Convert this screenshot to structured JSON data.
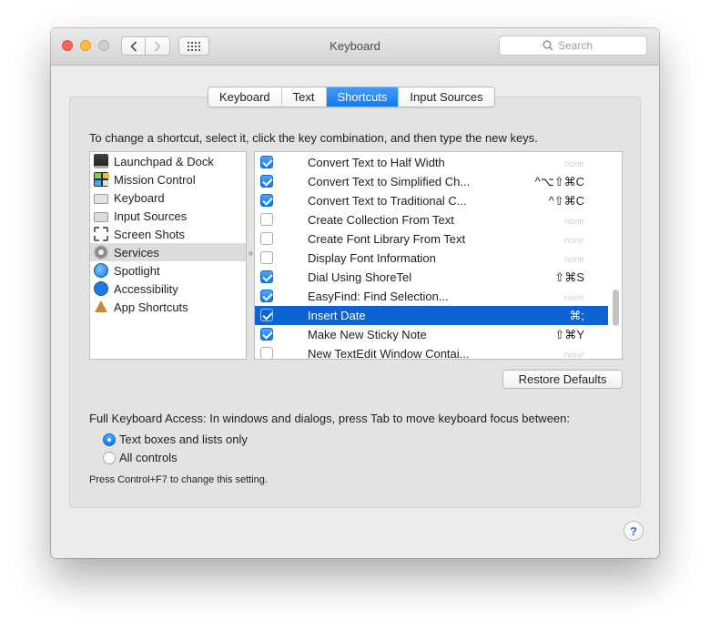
{
  "window": {
    "title": "Keyboard"
  },
  "toolbar": {
    "back_icon": "chevron-left-icon",
    "forward_icon": "chevron-right-icon",
    "show_all_icon": "grid-icon",
    "search_placeholder": "Search"
  },
  "tabs": [
    {
      "label": "Keyboard",
      "active": false
    },
    {
      "label": "Text",
      "active": false
    },
    {
      "label": "Shortcuts",
      "active": true
    },
    {
      "label": "Input Sources",
      "active": false
    }
  ],
  "instructions": "To change a shortcut, select it, click the key combination, and then type the new keys.",
  "categories": [
    {
      "label": "Launchpad & Dock",
      "icon": "launchpad-icon"
    },
    {
      "label": "Mission Control",
      "icon": "mission-control-icon"
    },
    {
      "label": "Keyboard",
      "icon": "keyboard-icon"
    },
    {
      "label": "Input Sources",
      "icon": "input-sources-icon"
    },
    {
      "label": "Screen Shots",
      "icon": "screenshot-icon"
    },
    {
      "label": "Services",
      "icon": "services-gear-icon",
      "selected": true
    },
    {
      "label": "Spotlight",
      "icon": "spotlight-icon"
    },
    {
      "label": "Accessibility",
      "icon": "accessibility-icon"
    },
    {
      "label": "App Shortcuts",
      "icon": "app-shortcuts-icon"
    }
  ],
  "services": [
    {
      "name": "Convert Text to Half Width",
      "checked": true,
      "shortcut": "none"
    },
    {
      "name": "Convert Text to Simplified Ch...",
      "checked": true,
      "shortcut": "^⌥⇧⌘C"
    },
    {
      "name": "Convert Text to Traditional C...",
      "checked": true,
      "shortcut": "^⇧⌘C"
    },
    {
      "name": "Create Collection From Text",
      "checked": false,
      "shortcut": "none"
    },
    {
      "name": "Create Font Library From Text",
      "checked": false,
      "shortcut": "none"
    },
    {
      "name": "Display Font Information",
      "checked": false,
      "shortcut": "none"
    },
    {
      "name": "Dial Using ShoreTel",
      "checked": true,
      "shortcut": "⇧⌘S"
    },
    {
      "name": "EasyFind: Find Selection...",
      "checked": true,
      "shortcut": "none"
    },
    {
      "name": "Insert Date",
      "checked": true,
      "shortcut": "⌘;",
      "selected": true
    },
    {
      "name": "Make New Sticky Note",
      "checked": true,
      "shortcut": "⇧⌘Y"
    },
    {
      "name": "New TextEdit Window Contai...",
      "checked": false,
      "shortcut": "none"
    }
  ],
  "restore_defaults": "Restore Defaults",
  "full_keyboard_access": {
    "label": "Full Keyboard Access: In windows and dialogs, press Tab to move keyboard focus between:",
    "options": [
      {
        "label": "Text boxes and lists only",
        "selected": true
      },
      {
        "label": "All controls",
        "selected": false
      }
    ],
    "hint": "Press Control+F7 to change this setting."
  },
  "help": "?"
}
